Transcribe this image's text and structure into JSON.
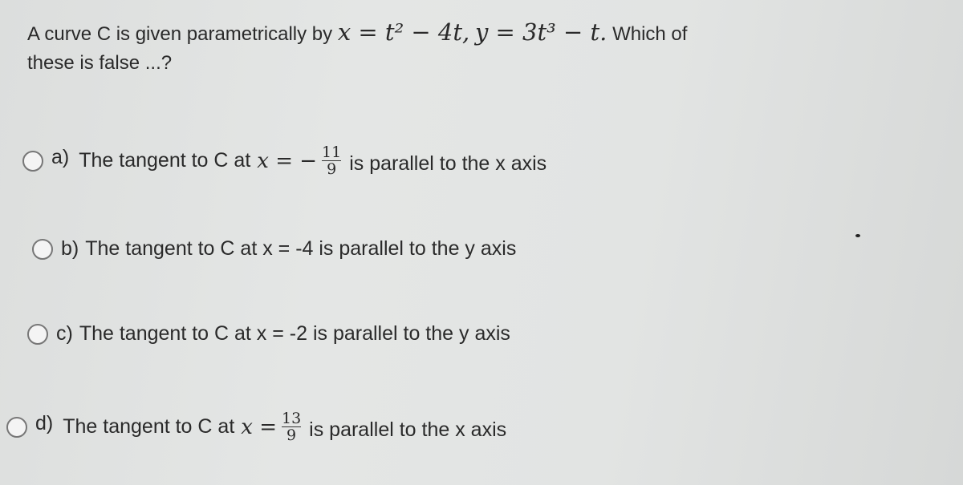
{
  "question": {
    "prefix": "A curve C is given parametrically by",
    "equation_x": "x = t² − 4t,",
    "equation_y": "y = 3t³ − t.",
    "suffix": "Which of",
    "line2": "these is false ...?"
  },
  "options": [
    {
      "letter": "a)",
      "text_before": "The tangent to C at",
      "math": "x = −",
      "frac_num": "11",
      "frac_den": "9",
      "text_after": "is parallel to the x axis"
    },
    {
      "letter": "b)",
      "text": "The tangent to C at x = -4 is parallel to the y axis"
    },
    {
      "letter": "c)",
      "text": "The tangent to C at x = -2 is parallel to the y axis"
    },
    {
      "letter": "d)",
      "text_before": "The tangent to C at",
      "math": "x =",
      "frac_num": "13",
      "frac_den": "9",
      "text_after": "is parallel to the x axis"
    }
  ]
}
